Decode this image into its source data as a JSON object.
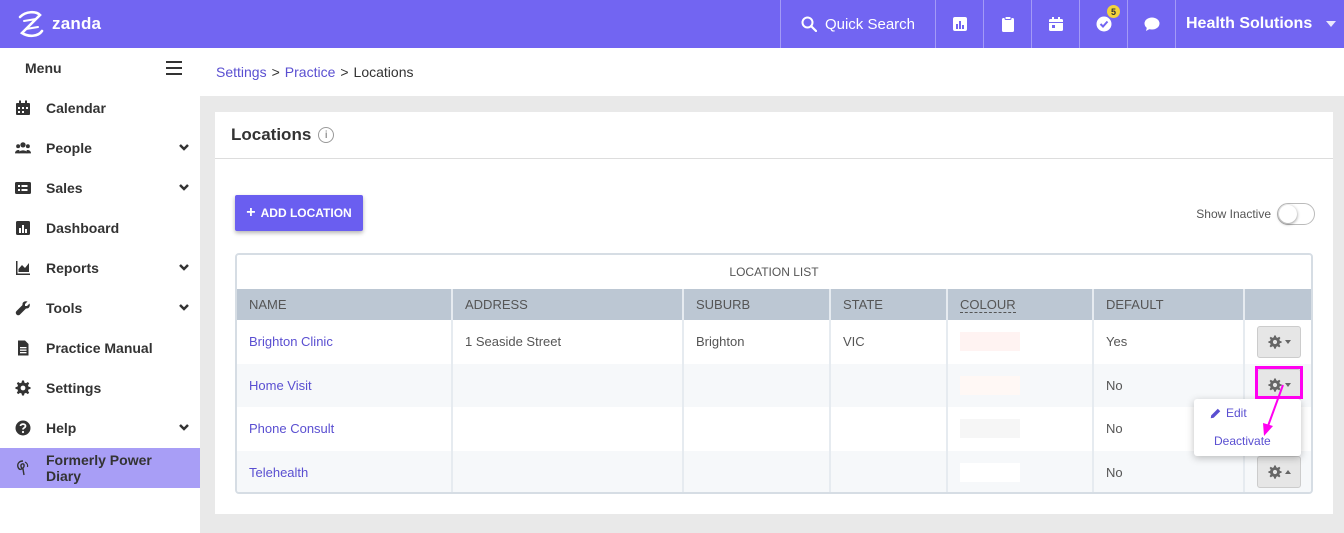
{
  "app": {
    "logo_text": "zanda",
    "quick_search": "Quick Search",
    "tasks_badge": "5",
    "org_name": "Health Solutions"
  },
  "sidebar": {
    "menu_label": "Menu",
    "items": [
      {
        "label": "Calendar",
        "icon": "calendar-icon",
        "expandable": false
      },
      {
        "label": "People",
        "icon": "people-icon",
        "expandable": true
      },
      {
        "label": "Sales",
        "icon": "sales-icon",
        "expandable": true
      },
      {
        "label": "Dashboard",
        "icon": "dashboard-icon",
        "expandable": false
      },
      {
        "label": "Reports",
        "icon": "reports-icon",
        "expandable": true
      },
      {
        "label": "Tools",
        "icon": "wrench-icon",
        "expandable": true
      },
      {
        "label": "Practice Manual",
        "icon": "document-icon",
        "expandable": false
      },
      {
        "label": "Settings",
        "icon": "gear-icon",
        "expandable": false
      },
      {
        "label": "Help",
        "icon": "help-icon",
        "expandable": true
      },
      {
        "label": "Formerly Power Diary",
        "icon": "power-diary-icon",
        "expandable": false,
        "active": true
      }
    ]
  },
  "breadcrumb": {
    "settings": "Settings",
    "practice": "Practice",
    "current": "Locations",
    "separator": ">"
  },
  "panel": {
    "title": "Locations",
    "add_button": "ADD LOCATION",
    "show_inactive": "Show Inactive"
  },
  "table": {
    "caption": "LOCATION LIST",
    "headers": [
      "NAME",
      "ADDRESS",
      "SUBURB",
      "STATE",
      "COLOUR",
      "DEFAULT"
    ],
    "rows": [
      {
        "name": "Brighton Clinic",
        "address": "1 Seaside Street",
        "suburb": "Brighton",
        "state": "VIC",
        "colour": "#fff3f2",
        "default": "Yes"
      },
      {
        "name": "Home Visit",
        "address": "",
        "suburb": "",
        "state": "",
        "colour": "#fff8f5",
        "default": "No"
      },
      {
        "name": "Phone Consult",
        "address": "",
        "suburb": "",
        "state": "",
        "colour": "#f6f6f6",
        "default": "No"
      },
      {
        "name": "Telehealth",
        "address": "",
        "suburb": "",
        "state": "",
        "colour": "#ffffff",
        "default": "No"
      }
    ]
  },
  "dropdown": {
    "edit": "Edit",
    "deactivate": "Deactivate"
  },
  "colors": {
    "brand": "#7265f2",
    "link": "#5a4fd1",
    "highlight": "#ff00f0"
  }
}
